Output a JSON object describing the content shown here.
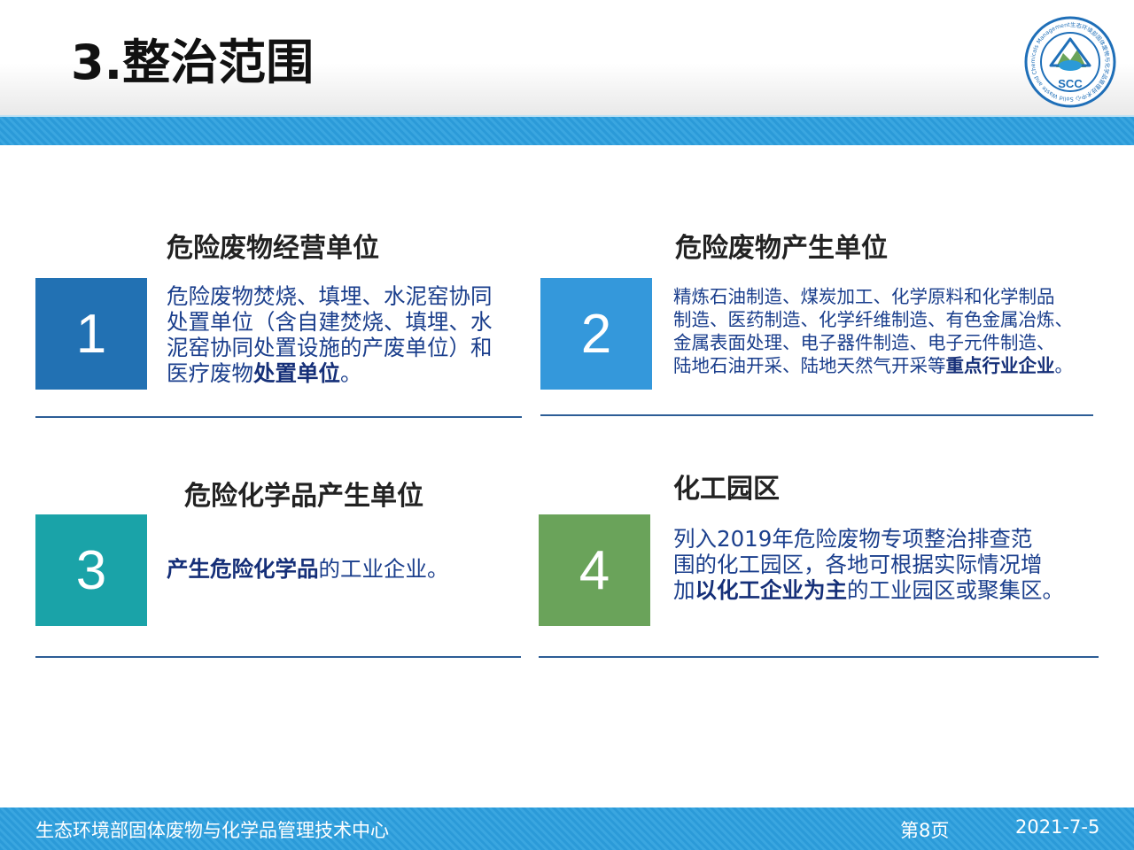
{
  "header": {
    "title": "3.整治范围",
    "logo": {
      "abbr": "SCC",
      "ring_text": "生态环境部固体废物与化学品管理技术中心 Solid Waste and Chemicals Management Center, MEE"
    }
  },
  "cards": [
    {
      "number": "1",
      "heading": "危险废物经营单位",
      "color": "#2271b3",
      "body_lines": [
        {
          "text": "危险废物焚烧、填埋、水泥窑协同"
        },
        {
          "text": "处置单位（含自建焚烧、填埋、水"
        },
        {
          "text": "泥窑协同处置设施的产废单位）和"
        },
        {
          "text": "医疗废物",
          "bold": "处置单位",
          "tail": "。"
        }
      ]
    },
    {
      "number": "2",
      "heading": "危险废物产生单位",
      "color": "#3498db",
      "body_lines": [
        {
          "text": "精炼石油制造、煤炭加工、化学原料和化学制品"
        },
        {
          "text": "制造、医药制造、化学纤维制造、有色金属冶炼、"
        },
        {
          "text": "金属表面处理、电子器件制造、电子元件制造、"
        },
        {
          "text": "陆地石油开采、陆地天然气开采等",
          "bold": "重点行业企业",
          "tail": "。"
        }
      ]
    },
    {
      "number": "3",
      "heading": "危险化学品产生单位",
      "color": "#1aa3a8",
      "body_lines": [
        {
          "text": "",
          "bold": "产生危险化学品",
          "tail": "的工业企业。"
        }
      ]
    },
    {
      "number": "4",
      "heading": "化工园区",
      "color": "#6aa35a",
      "body_lines": [
        {
          "text": "列入2019年危险废物专项整治排查范"
        },
        {
          "text": "围的化工园区，各地可根据实际情况增"
        },
        {
          "text": "加",
          "bold": "以化工企业为主",
          "tail": "的工业园区或聚集区。"
        }
      ]
    }
  ],
  "footer": {
    "org": "生态环境部固体废物与化学品管理技术中心",
    "page": "第8页",
    "date": "2021-7-5"
  }
}
